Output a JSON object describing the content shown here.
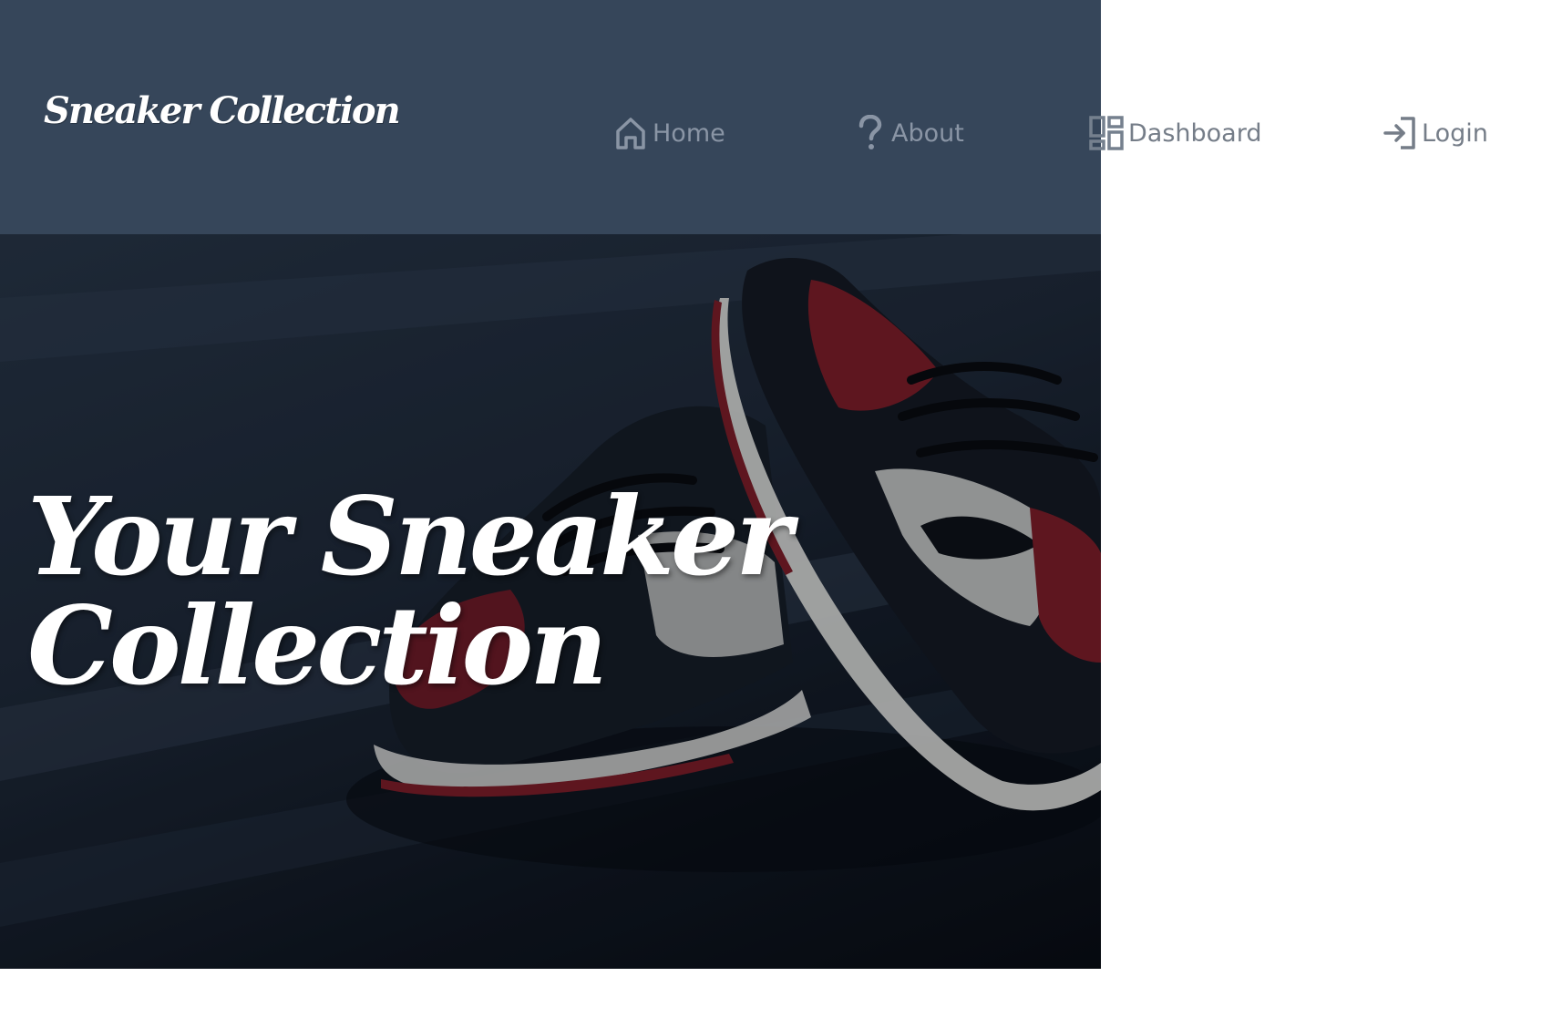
{
  "header": {
    "brand": "Sneaker Collection",
    "nav": [
      {
        "label": "Home",
        "icon": "home-icon"
      },
      {
        "label": "About",
        "icon": "question-icon"
      },
      {
        "label": "Dashboard",
        "icon": "dashboard-icon"
      },
      {
        "label": "Login",
        "icon": "login-icon"
      }
    ]
  },
  "hero": {
    "title_line1": "Your Sneaker",
    "title_line2": "Collection"
  },
  "colors": {
    "header_bg": "#36465a",
    "nav_text": "#8a95a5",
    "hero_text": "#ffffff",
    "sneaker_red": "#7a1822"
  }
}
